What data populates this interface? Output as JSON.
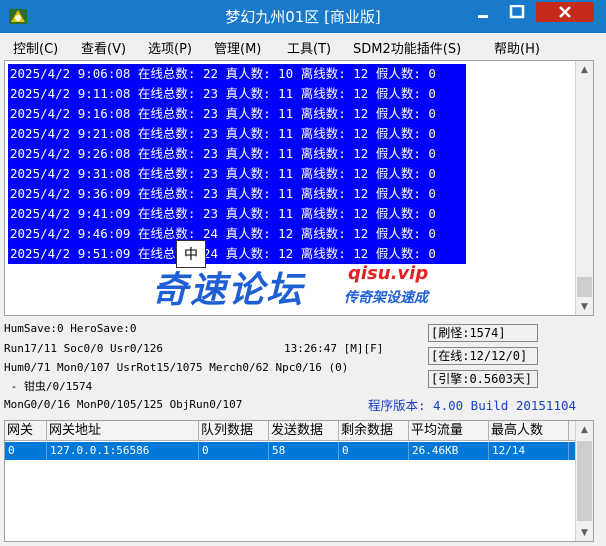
{
  "window": {
    "title": "梦幻九州01区 [商业版]",
    "colors": {
      "titlebar": "#1979ca",
      "log_highlight": "#0000ff",
      "row_selected": "#0078d7",
      "close": "#c42b1c"
    }
  },
  "menu": {
    "items": [
      {
        "label": "控制(C)"
      },
      {
        "label": "查看(V)"
      },
      {
        "label": "选项(P)"
      },
      {
        "label": "管理(M)"
      },
      {
        "label": "工具(T)"
      },
      {
        "label": "SDM2功能插件(S)"
      },
      {
        "label": "帮助(H)"
      }
    ]
  },
  "log": {
    "lines": [
      {
        "text": "2025/4/2 9:06:08 在线总数: 22 真人数: 10 离线数: 12 假人数: 0"
      },
      {
        "text": "2025/4/2 9:11:08 在线总数: 23 真人数: 11 离线数: 12 假人数: 0"
      },
      {
        "text": "2025/4/2 9:16:08 在线总数: 23 真人数: 11 离线数: 12 假人数: 0"
      },
      {
        "text": "2025/4/2 9:21:08 在线总数: 23 真人数: 11 离线数: 12 假人数: 0"
      },
      {
        "text": "2025/4/2 9:26:08 在线总数: 23 真人数: 11 离线数: 12 假人数: 0"
      },
      {
        "text": "2025/4/2 9:31:08 在线总数: 23 真人数: 11 离线数: 12 假人数: 0"
      },
      {
        "text": "2025/4/2 9:36:09 在线总数: 23 真人数: 11 离线数: 12 假人数: 0"
      },
      {
        "text": "2025/4/2 9:41:09 在线总数: 23 真人数: 11 离线数: 12 假人数: 0"
      },
      {
        "text": "2025/4/2 9:46:09 在线总数: 24 真人数: 12 离线数: 12 假人数: 0"
      },
      {
        "text": "2025/4/2 9:51:09 在线总数: 24 真人数: 12 离线数: 12 假人数: 0"
      }
    ]
  },
  "ime": {
    "label": "中"
  },
  "watermark": {
    "brand": "奇速论坛",
    "site": "qisu.vip",
    "slogan": "传奇架设速成"
  },
  "status": {
    "hum_save": "HumSave:0 HeroSave:0",
    "run": "Run17/11 Soc0/0 Usr0/126",
    "clock": "13:26:47 [M][F]",
    "hum": "Hum0/71 Mon0/107 UsrRot15/1075 Merch0/62 Npc0/16 (0)",
    "bug": " - 钳虫/0/1574",
    "mon": "MonG0/0/16 MonP0/105/125 ObjRun0/107",
    "refresh": "[刷怪:1574]",
    "online": "[在线:12/12/0]",
    "engine": "[引擎:0.5603天]",
    "version": "程序版本: 4.00 Build 20151104"
  },
  "gateway": {
    "columns": [
      "网关",
      "网关地址",
      "队列数据",
      "发送数据",
      "剩余数据",
      "平均流量",
      "最高人数"
    ],
    "rows": [
      {
        "cells": [
          "0",
          "127.0.0.1:56586",
          "0",
          "58",
          "0",
          "26.46KB",
          "12/14"
        ]
      }
    ]
  }
}
